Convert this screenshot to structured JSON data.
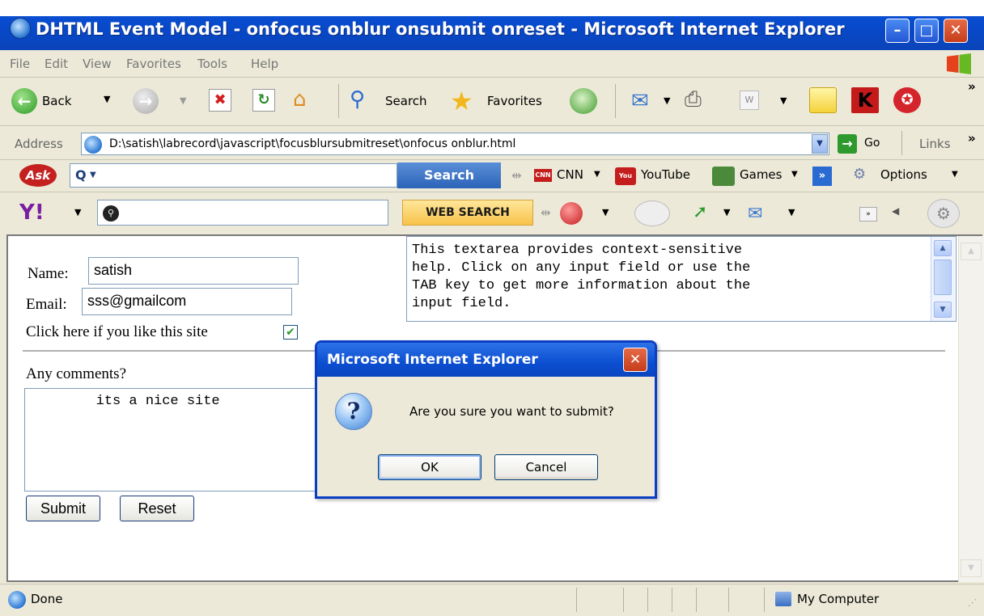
{
  "window": {
    "title": "DHTML Event Model - onfocus onblur onsubmit onreset - Microsoft Internet Explorer",
    "min_glyph": "–",
    "max_glyph": "□",
    "close_glyph": "✕"
  },
  "menu": [
    "File",
    "Edit",
    "View",
    "Favorites",
    "Tools",
    "Help"
  ],
  "toolbar": {
    "back_label": "Back",
    "search_label": "Search",
    "favorites_label": "Favorites",
    "chevron": "»"
  },
  "address_bar": {
    "label": "Address",
    "url": "D:\\satish\\labrecord\\javascript\\focusblursubmitreset\\onfocus onblur.html",
    "go_label": "Go",
    "links_label": "Links",
    "chevron": "»"
  },
  "ask_toolbar": {
    "logo": "Ask",
    "search_glyph": "Q",
    "search_button": "Search",
    "cnn_label": "CNN",
    "youtube_label": "YouTube",
    "games_label": "Games",
    "options_label": "Options"
  },
  "yahoo_toolbar": {
    "logo": "Y!",
    "search_button": "WEB SEARCH"
  },
  "form": {
    "name_label": "Name:",
    "name_value": "satish",
    "email_label": "Email:",
    "email_value": "sss@gmailcom",
    "like_label": "Click here if you like this site",
    "like_checked": true,
    "comments_label": "Any comments?",
    "comments_value": "        its a nice site",
    "submit_label": "Submit",
    "reset_label": "Reset",
    "help_lines": [
      "This textarea provides context-sensitive",
      "help. Click on any input field or use the",
      "TAB key to get more information about the",
      "input field."
    ]
  },
  "dialog": {
    "title": "Microsoft Internet Explorer",
    "message": "Are you sure you want to submit?",
    "ok_label": "OK",
    "cancel_label": "Cancel",
    "icon_glyph": "?"
  },
  "status_bar": {
    "status": "Done",
    "zone": "My Computer"
  }
}
